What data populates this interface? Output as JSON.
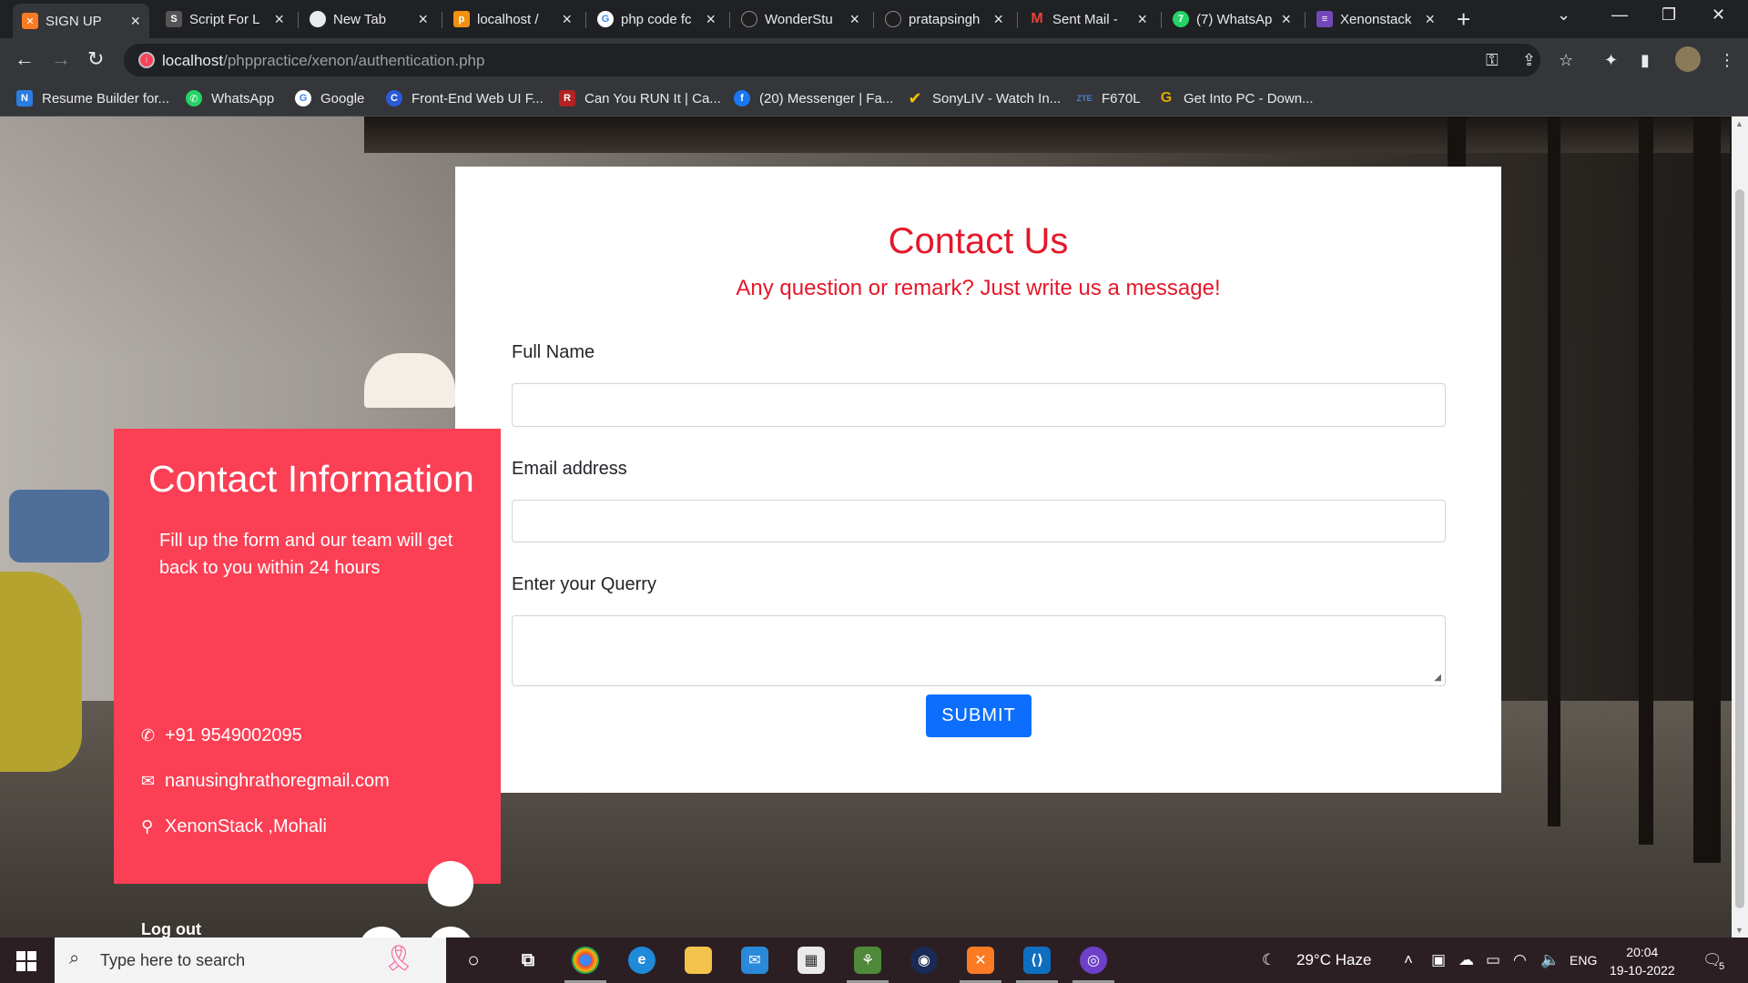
{
  "browser": {
    "tabs": [
      {
        "title": "SIGN UP",
        "icon": "xampp-icon",
        "color": "#fb7a24",
        "active": true
      },
      {
        "title": "Script For L",
        "icon": "script-icon",
        "color": "#cccccc",
        "active": false
      },
      {
        "title": "New Tab",
        "icon": "chrome-icon",
        "color": "#e8eaed",
        "active": false
      },
      {
        "title": "localhost /",
        "icon": "phpmyadmin-icon",
        "color": "#f29111",
        "active": false
      },
      {
        "title": "php code fc",
        "icon": "google-icon",
        "color": "#ffffff",
        "active": false
      },
      {
        "title": "WonderStu",
        "icon": "github-icon",
        "color": "#1f1f1f",
        "active": false
      },
      {
        "title": "pratapsingh",
        "icon": "github-icon",
        "color": "#1f1f1f",
        "active": false
      },
      {
        "title": "Sent Mail -",
        "icon": "gmail-icon",
        "color": "#ea4335",
        "active": false
      },
      {
        "title": "(7) WhatsAp",
        "icon": "whatsapp-icon",
        "color": "#25d366",
        "active": false
      },
      {
        "title": "Xenonstack",
        "icon": "forms-icon",
        "color": "#7248b9",
        "active": false
      }
    ],
    "url_host": "localhost",
    "url_path": "/phppractice/xenon/authentication.php",
    "bookmarks": [
      {
        "label": "Resume Builder for...",
        "icon": "novoresume-icon",
        "color": "#2a7de1"
      },
      {
        "label": "WhatsApp",
        "icon": "whatsapp-icon",
        "color": "#25d366"
      },
      {
        "label": "Google",
        "icon": "google-icon",
        "color": "#ffffff"
      },
      {
        "label": "Front-End Web UI F...",
        "icon": "frontend-icon",
        "color": "#2a5bd7"
      },
      {
        "label": "Can You RUN It | Ca...",
        "icon": "canyourunit-icon",
        "color": "#b22222"
      },
      {
        "label": "(20) Messenger | Fa...",
        "icon": "facebook-icon",
        "color": "#1877f2"
      },
      {
        "label": "SonyLIV - Watch In...",
        "icon": "sonyliv-icon",
        "color": "#f5c400"
      },
      {
        "label": "F670L",
        "icon": "zte-icon",
        "color": "#1e5aa8"
      },
      {
        "label": "Get Into PC - Down...",
        "icon": "getintopc-icon",
        "color": "#e0a800"
      }
    ]
  },
  "form": {
    "title": "Contact Us",
    "subtitle": "Any question or remark? Just write us a message!",
    "fields": [
      {
        "label": "Full Name",
        "value": "",
        "placeholder": ""
      },
      {
        "label": "Email address",
        "value": "",
        "placeholder": ""
      },
      {
        "label": "Enter your Querry",
        "value": "",
        "placeholder": ""
      }
    ],
    "submit_label": "SUBMIT",
    "accent_color": "#e4182a",
    "button_color": "#0d6efd"
  },
  "contact_info": {
    "title": "Contact Information",
    "description": "Fill up the form and our team will get back to you within 24 hours",
    "phone": "+91 9549002095",
    "email": "nanusinghrathoregmail.com",
    "location": "XenonStack ,Mohali",
    "logout_label": "Log out",
    "panel_color": "#fb3f54"
  },
  "taskbar": {
    "search_placeholder": "Type here to search",
    "weather": "29°C  Haze",
    "language": "ENG",
    "time": "20:04",
    "date": "19-10-2022",
    "notification_count": "5"
  }
}
